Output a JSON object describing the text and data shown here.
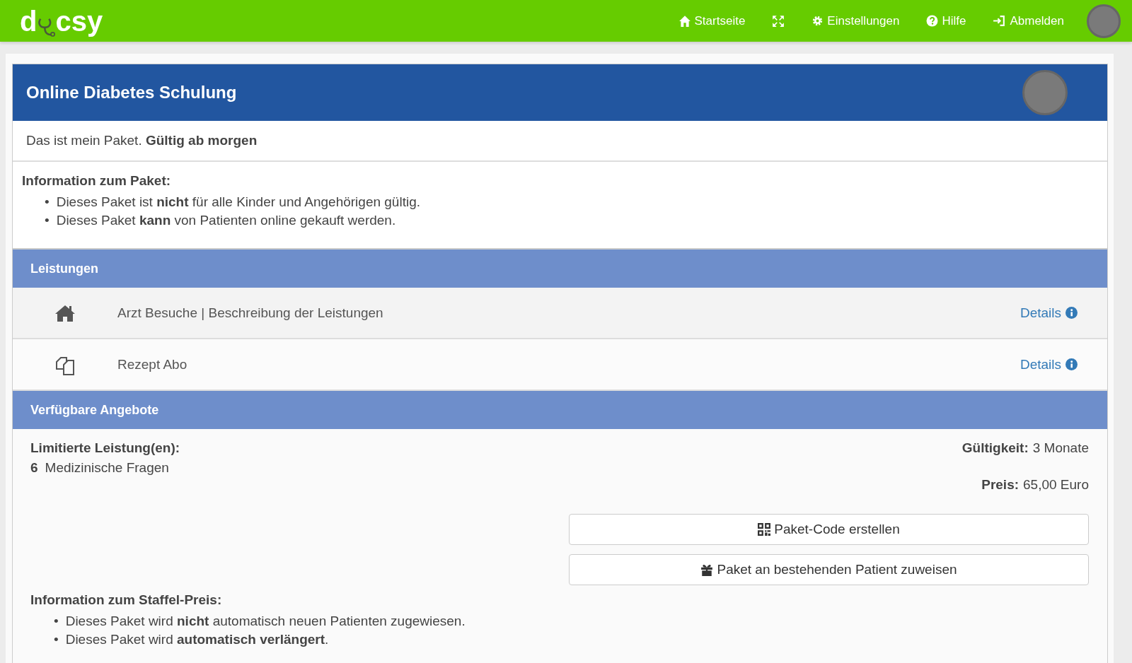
{
  "nav": {
    "logo": {
      "before": "d",
      "after": "csy"
    },
    "items": [
      {
        "kind": "home",
        "label": "Startseite"
      },
      {
        "kind": "expand"
      },
      {
        "kind": "gear",
        "label": "Einstellungen"
      },
      {
        "kind": "help",
        "label": "Hilfe"
      },
      {
        "kind": "logout",
        "label": "Abmelden"
      }
    ]
  },
  "package": {
    "title": "Online Diabetes Schulung",
    "subtitle": "Das ist mein Paket. **Gültig ab morgen**",
    "info_heading": "Information zum Paket:",
    "info_items": [
      {
        "bullet": "•",
        "text": "Dieses Paket ist **nicht** für alle Kinder und Angehörigen gültig."
      },
      {
        "bullet": "•",
        "text": "Dieses Paket **kann** von Patienten online gekauft werden."
      }
    ]
  },
  "services": {
    "heading": "Leistungen",
    "rows": [
      {
        "kind": "home",
        "label": "Arzt Besuche | Beschreibung der Leistungen",
        "link": "Details"
      },
      {
        "kind": "copy",
        "label": "Rezept Abo",
        "link": "Details"
      }
    ]
  },
  "offers": {
    "heading": "Verfügbare Angebote",
    "limited_heading": "Limitierte Leistung(en):",
    "limited_count": "6",
    "limited_label": "Medizinische Fragen",
    "validity_label": "Gültigkeit:",
    "validity": "3 Monate",
    "price_label": "Preis:",
    "price": "65,00 Euro",
    "buttons": [
      {
        "kind": "qr",
        "label": "Paket-Code erstellen"
      },
      {
        "kind": "gift",
        "label": "Paket an bestehenden Patient zuweisen"
      }
    ],
    "tier_heading": "Information zum Staffel-Preis:",
    "tier_items": [
      {
        "bullet": "•",
        "text": "Dieses Paket wird **nicht** automatisch neuen Patienten zugewiesen."
      },
      {
        "bullet": "•",
        "text": "Dieses Paket wird **automatisch verlängert**."
      }
    ]
  }
}
